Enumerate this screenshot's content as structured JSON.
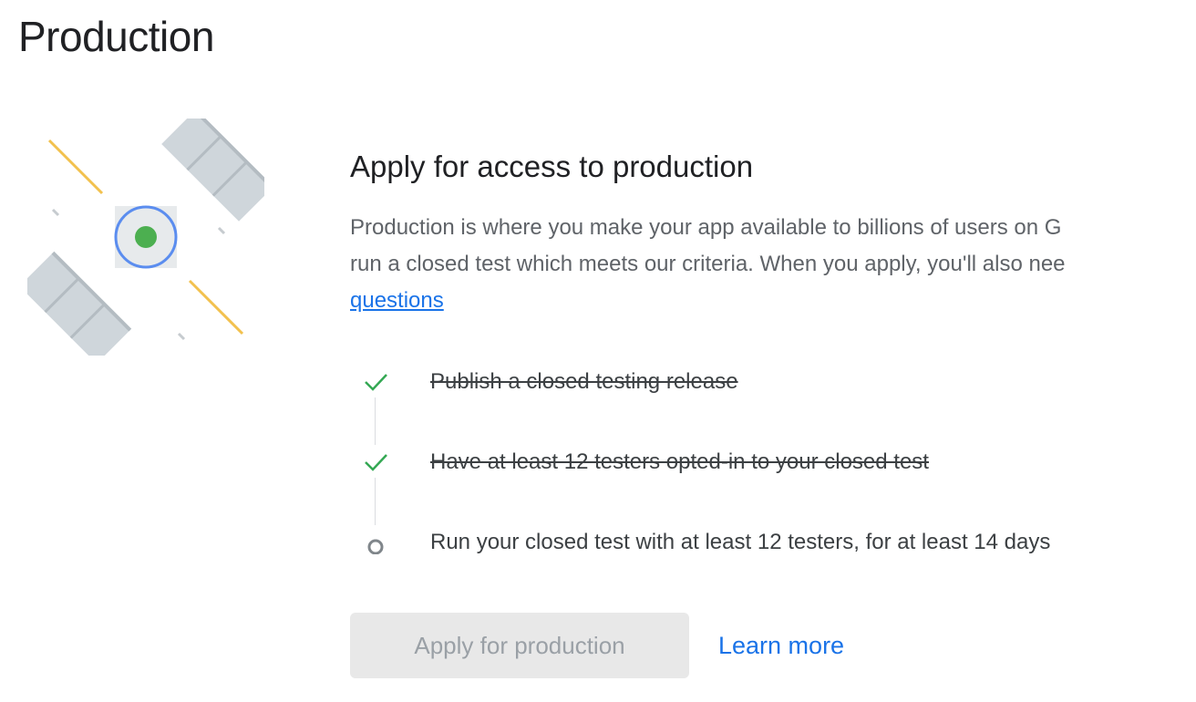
{
  "page": {
    "title": "Production"
  },
  "illustration": {
    "icon": "satellite-icon",
    "colors": {
      "panel": "#cfd6db",
      "panel_line": "#b4bcc2",
      "ring": "#5b8def",
      "dot": "#4caf50",
      "ray": "#f2c14e"
    }
  },
  "apply_section": {
    "title": "Apply for access to production",
    "description_line1": "Production is where you make your app available to billions of users on G",
    "description_line2": "run a closed test which meets our criteria. When you apply, you'll also nee",
    "description_link": "questions"
  },
  "steps": [
    {
      "label": "Publish a closed testing release",
      "status": "done",
      "icon": "check-icon"
    },
    {
      "label": "Have at least 12 testers opted-in to your closed test",
      "status": "done",
      "icon": "check-icon"
    },
    {
      "label": "Run your closed test with at least 12 testers, for at least 14 days",
      "status": "pending",
      "icon": "circle-icon"
    }
  ],
  "actions": {
    "apply_label": "Apply for production",
    "learn_more_label": "Learn more"
  },
  "colors": {
    "link": "#1a73e8",
    "check": "#34a853",
    "pending": "#80868b",
    "disabled_bg": "#e8e8e8",
    "disabled_text": "#9aa0a6"
  }
}
